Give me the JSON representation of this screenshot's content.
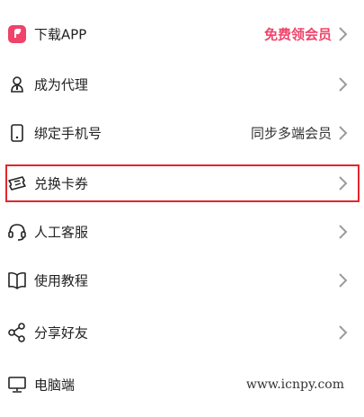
{
  "menu": {
    "items": [
      {
        "label": "下载APP",
        "right": "免费领会员",
        "icon": "app-logo-icon"
      },
      {
        "label": "成为代理",
        "right": "",
        "icon": "agent-icon"
      },
      {
        "label": "绑定手机号",
        "right": "同步多端会员",
        "icon": "phone-icon"
      },
      {
        "label": "兑换卡券",
        "right": "",
        "icon": "ticket-icon"
      },
      {
        "label": "人工客服",
        "right": "",
        "icon": "headset-icon"
      },
      {
        "label": "使用教程",
        "right": "",
        "icon": "book-icon"
      },
      {
        "label": "分享好友",
        "right": "",
        "icon": "share-icon"
      },
      {
        "label": "电脑端",
        "right": "",
        "icon": "monitor-icon"
      }
    ]
  },
  "watermark": "www.icnpy.com",
  "colors": {
    "accent": "#f0436a",
    "highlight_border": "#e3262c",
    "chevron": "#9a9a9a"
  }
}
